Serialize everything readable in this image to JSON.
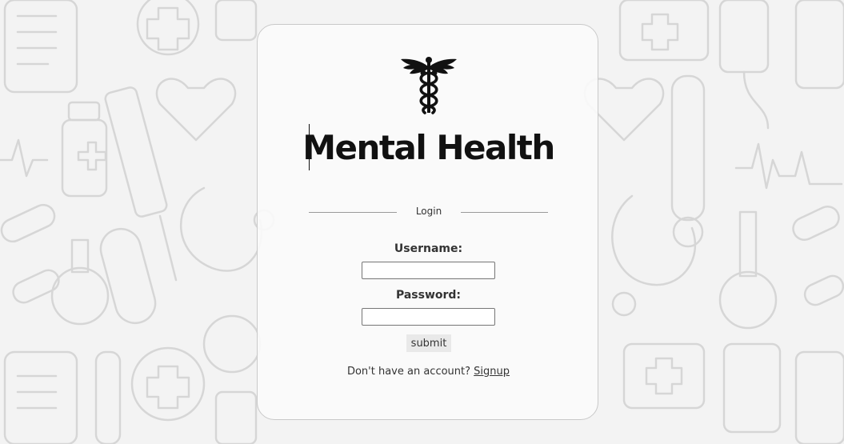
{
  "app": {
    "title": "Mental Health"
  },
  "login": {
    "legend": "Login",
    "username_label": "Username:",
    "username_value": "",
    "password_label": "Password:",
    "password_value": "",
    "submit_label": "submit",
    "signup_prompt": "Don't have an account?",
    "signup_link": "Signup"
  },
  "icons": {
    "logo": "caduceus-icon"
  },
  "colors": {
    "background": "#f3f3f3",
    "card": "#fafafa",
    "text": "#111111",
    "border": "#c9c9c9"
  }
}
